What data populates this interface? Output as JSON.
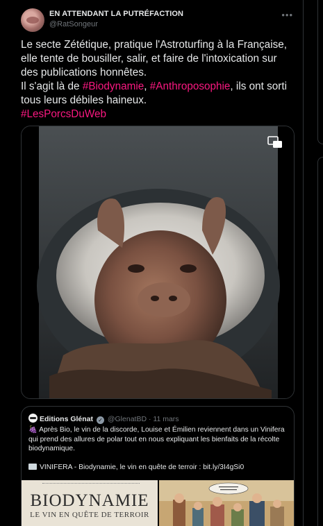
{
  "tweet": {
    "display_name": "EN ATTENDANT LA PUTRÉFACTION",
    "handle": "@RatSongeur",
    "text": {
      "line1": "Le secte Zététique, pratique l'Astroturfing à la Française, elle tente de bousiller, salir, et faire de l'intoxication sur des publications honnêtes.",
      "line2_pre": "Il s'agit là de ",
      "tag1": "#Biodynamie",
      "sep": ", ",
      "tag2": "#Anthroposophie",
      "line2_post": ", ils ont sorti tous leurs débiles haineux.",
      "tag3": "#LesPorcsDuWeb"
    }
  },
  "quoted": {
    "name": "Editions Glénat",
    "handle": "@GlenatBD",
    "dot": "·",
    "date": "11 mars",
    "paragraph1": " Après Bio, le vin de la discorde, Louise et Émilien reviennent dans un Vinifera qui prend des allures de polar tout en nous expliquant les bienfaits de la récolte biodynamique.",
    "paragraph2": "VINIFERA - Biodynamie, le vin en quête de terroir : bit.ly/3I4gSi0",
    "cover_title": "BIODYNAMIE",
    "cover_subtitle": "LE VIN EN QUÊTE DE TERROIR"
  },
  "icons": {
    "more": "more-icon",
    "expand": "expand-media-icon",
    "verified": "verified-badge-icon",
    "grape": "grape-emoji-icon",
    "book": "book-emoji-icon"
  },
  "colors": {
    "background": "#000000",
    "text": "#e7e9ea",
    "secondary": "#71767b",
    "hashtag": "#f91880",
    "border": "#2f3336"
  }
}
